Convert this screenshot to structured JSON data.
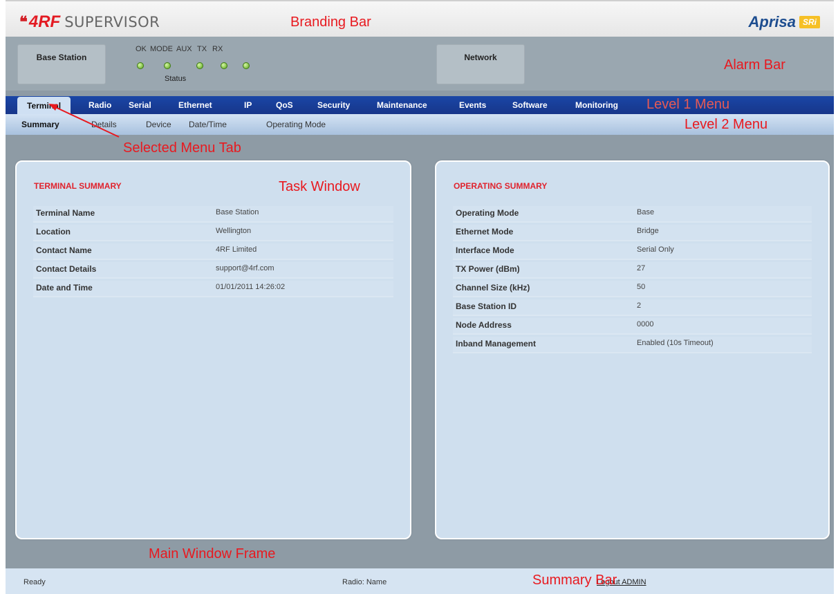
{
  "branding": {
    "logo_mark": "4RF",
    "logo_product": "SUPERVISOR",
    "brand_name": "Aprisa",
    "brand_badge": "SRi"
  },
  "alarm_bar": {
    "base_station_label": "Base Station",
    "network_label": "Network",
    "leds": [
      "OK",
      "MODE",
      "AUX",
      "TX",
      "RX"
    ],
    "status_label": "Status"
  },
  "menu1": {
    "items": [
      "Terminal",
      "Radio",
      "Serial",
      "Ethernet",
      "IP",
      "QoS",
      "Security",
      "Maintenance",
      "Events",
      "Software",
      "Monitoring"
    ],
    "selected": "Terminal"
  },
  "menu2": {
    "items": [
      "Summary",
      "Details",
      "Device",
      "Date/Time",
      "Operating Mode"
    ],
    "selected": "Summary"
  },
  "terminal_summary": {
    "title": "TERMINAL SUMMARY",
    "rows": [
      {
        "label": "Terminal Name",
        "value": "Base Station"
      },
      {
        "label": "Location",
        "value": "Wellington"
      },
      {
        "label": "Contact Name",
        "value": "4RF Limited"
      },
      {
        "label": "Contact Details",
        "value": "support@4rf.com"
      },
      {
        "label": "Date and Time",
        "value": "01/01/2011 14:26:02"
      }
    ]
  },
  "operating_summary": {
    "title": "OPERATING SUMMARY",
    "rows": [
      {
        "label": "Operating Mode",
        "value": "Base"
      },
      {
        "label": "Ethernet Mode",
        "value": "Bridge"
      },
      {
        "label": "Interface Mode",
        "value": "Serial Only"
      },
      {
        "label": "TX Power (dBm)",
        "value": "27"
      },
      {
        "label": "Channel Size (kHz)",
        "value": "50"
      },
      {
        "label": "Base Station ID",
        "value": "2"
      },
      {
        "label": "Node Address",
        "value": "0000"
      },
      {
        "label": "Inband Management",
        "value": "Enabled (10s Timeout)"
      }
    ]
  },
  "summary_bar": {
    "status": "Ready",
    "radio": "Radio: Name",
    "logout": "Logout ADMIN"
  },
  "annotations": {
    "branding_bar": "Branding Bar",
    "alarm_bar": "Alarm Bar",
    "level1_menu": "Level 1 Menu",
    "level2_menu": "Level 2 Menu",
    "selected_tab": "Selected Menu Tab",
    "task_window": "Task Window",
    "main_window_frame": "Main Window Frame",
    "summary_bar": "Summary Bar"
  },
  "colors": {
    "menu1_bg": "#1a46a6",
    "annotation": "#e8191f",
    "section_title": "#e0222c",
    "led_green": "#57a31a"
  }
}
